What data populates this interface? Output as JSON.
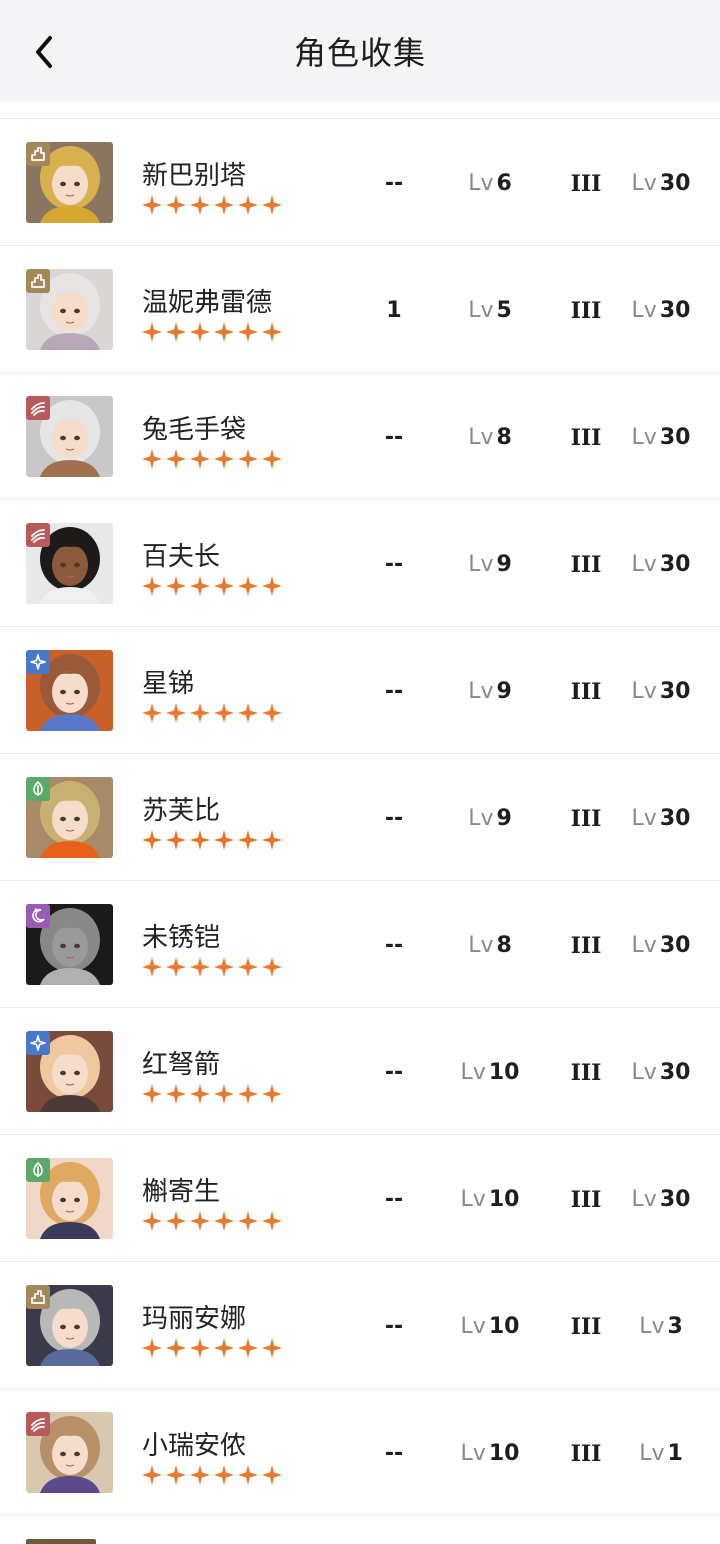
{
  "header": {
    "title": "角色收集"
  },
  "colors": {
    "star": "#e8782a",
    "hair": "#d8b050",
    "skin": "#f5dccb"
  },
  "characters": [
    {
      "name": "新巴别塔",
      "dupes": "--",
      "level_prefix": "Lv",
      "level": "6",
      "rank": "III",
      "skill_prefix": "Lv",
      "skill_level": "30",
      "stars": 6,
      "element_icon": "tower-icon",
      "element_color": "#a5885a",
      "hair": "#d8b050",
      "bg": "#8a7560",
      "accent": "#d4a830"
    },
    {
      "name": "温妮弗雷德",
      "dupes": "1",
      "level_prefix": "Lv",
      "level": "5",
      "rank": "III",
      "skill_prefix": "Lv",
      "skill_level": "30",
      "stars": 6,
      "element_icon": "tower-icon",
      "element_color": "#a5885a",
      "hair": "#e8e4e4",
      "bg": "#d9d6d6",
      "accent": "#b8a7b8"
    },
    {
      "name": "兔毛手袋",
      "dupes": "--",
      "level_prefix": "Lv",
      "level": "8",
      "rank": "III",
      "skill_prefix": "Lv",
      "skill_level": "30",
      "stars": 6,
      "element_icon": "beast-icon",
      "element_color": "#b95a5a",
      "hair": "#e6e6e6",
      "bg": "#c8c8c8",
      "accent": "#a07050"
    },
    {
      "name": "百夫长",
      "dupes": "--",
      "level_prefix": "Lv",
      "level": "9",
      "rank": "III",
      "skill_prefix": "Lv",
      "skill_level": "30",
      "stars": 6,
      "element_icon": "beast-icon",
      "element_color": "#b95a5a",
      "hair": "#1e1a1a",
      "bg": "#e8e8e8",
      "accent": "#f0f0f0",
      "skin": "#8a5a3a"
    },
    {
      "name": "星锑",
      "dupes": "--",
      "level_prefix": "Lv",
      "level": "9",
      "rank": "III",
      "skill_prefix": "Lv",
      "skill_level": "30",
      "stars": 6,
      "element_icon": "star-icon",
      "element_color": "#4a78c8",
      "hair": "#9a5a3a",
      "bg": "#c8602a",
      "accent": "#5a78c8"
    },
    {
      "name": "苏芙比",
      "dupes": "--",
      "level_prefix": "Lv",
      "level": "9",
      "rank": "III",
      "skill_prefix": "Lv",
      "skill_level": "30",
      "stars": 6,
      "element_icon": "leaf-icon",
      "element_color": "#5aa86a",
      "hair": "#c8b070",
      "bg": "#a88a6a",
      "accent": "#e8601a"
    },
    {
      "name": "未锈铠",
      "dupes": "--",
      "level_prefix": "Lv",
      "level": "8",
      "rank": "III",
      "skill_prefix": "Lv",
      "skill_level": "30",
      "stars": 6,
      "element_icon": "moon-icon",
      "element_color": "#9a5ab8",
      "hair": "#888888",
      "bg": "#1a1a1a",
      "accent": "#b0b0b0",
      "skin": "#9a9a9a"
    },
    {
      "name": "红弩箭",
      "dupes": "--",
      "level_prefix": "Lv",
      "level": "10",
      "rank": "III",
      "skill_prefix": "Lv",
      "skill_level": "30",
      "stars": 6,
      "element_icon": "star-icon",
      "element_color": "#4a78c8",
      "hair": "#f0c8a0",
      "bg": "#7a4a3a",
      "accent": "#4a3a3a"
    },
    {
      "name": "槲寄生",
      "dupes": "--",
      "level_prefix": "Lv",
      "level": "10",
      "rank": "III",
      "skill_prefix": "Lv",
      "skill_level": "30",
      "stars": 6,
      "element_icon": "leaf-icon",
      "element_color": "#5aa86a",
      "hair": "#e0a860",
      "bg": "#f0d8c8",
      "accent": "#3a3a5a"
    },
    {
      "name": "玛丽安娜",
      "dupes": "--",
      "level_prefix": "Lv",
      "level": "10",
      "rank": "III",
      "skill_prefix": "Lv",
      "skill_level": "3",
      "stars": 6,
      "element_icon": "tower-icon",
      "element_color": "#a5885a",
      "hair": "#b8b8b8",
      "bg": "#3a3a4a",
      "accent": "#5a6a9a"
    },
    {
      "name": "小瑞安侬",
      "dupes": "--",
      "level_prefix": "Lv",
      "level": "10",
      "rank": "III",
      "skill_prefix": "Lv",
      "skill_level": "1",
      "stars": 6,
      "element_icon": "beast-icon",
      "element_color": "#b95a5a",
      "hair": "#b89068",
      "bg": "#d8c8b0",
      "accent": "#5a4a8a"
    }
  ]
}
